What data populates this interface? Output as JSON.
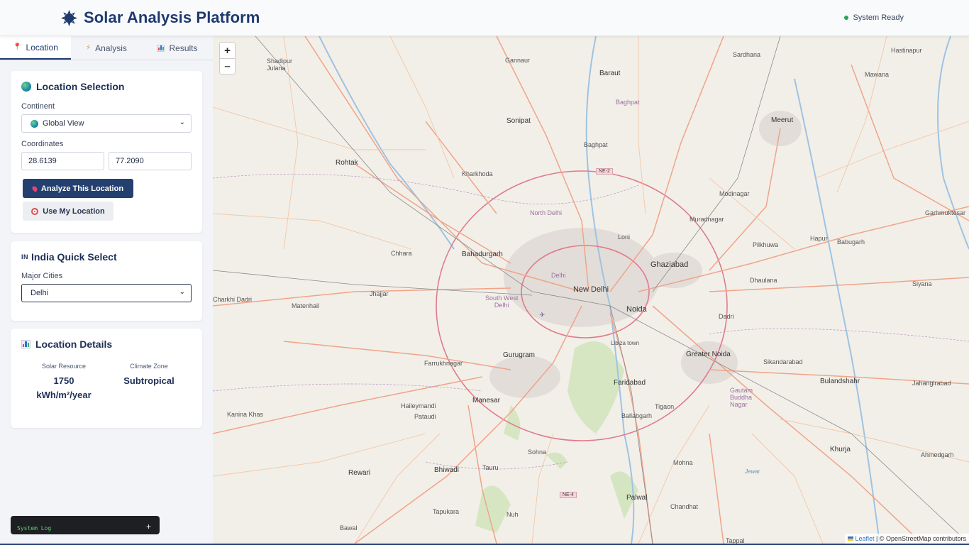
{
  "header": {
    "title": "Solar Analysis Platform",
    "status": "System Ready"
  },
  "tabs": [
    {
      "label": "Location",
      "icon": "pin-icon",
      "active": true
    },
    {
      "label": "Analysis",
      "icon": "lightning-icon",
      "active": false
    },
    {
      "label": "Results",
      "icon": "bar-chart-icon",
      "active": false
    }
  ],
  "location_card": {
    "title": "Location Selection",
    "continent_label": "Continent",
    "continent_value": "Global View",
    "coordinates_label": "Coordinates",
    "latitude": "28.6139",
    "longitude": "77.2090",
    "analyze_button": "Analyze This Location",
    "my_location_button": "Use My Location"
  },
  "india_card": {
    "flag": "IN",
    "title": "India Quick Select",
    "cities_label": "Major Cities",
    "city_value": "Delhi"
  },
  "details_card": {
    "title": "Location Details",
    "solar_label": "Solar Resource",
    "solar_value_num": "1750",
    "solar_value_unit": "kWh/m²/year",
    "climate_label": "Climate Zone",
    "climate_value": "Subtropical"
  },
  "log": {
    "label": "System Log",
    "toggle": "+"
  },
  "map": {
    "zoom_in": "+",
    "zoom_out": "–",
    "attribution_link": "Leaflet",
    "attribution_text": " | © OpenStreetMap contributors",
    "labels": {
      "shadipur_julana": "Shadipur\nJulana",
      "gannaur": "Gannaur",
      "baraut": "Baraut",
      "sardhana": "Sardhana",
      "hastinapur": "Hastinapur",
      "mawana": "Mawana",
      "sonipat": "Sonipat",
      "baghpat": "Baghpat",
      "meerut": "Meerut",
      "rohtak": "Rohtak",
      "kharkhoda": "Kharkhoda",
      "modinagar": "Modinagar",
      "muradnagar": "Muradnagar",
      "garhmuktesar": "Garhmuktesar",
      "north_delhi": "North Delhi",
      "loni": "Loni",
      "hapur": "Hapur",
      "babugarh": "Babugarh",
      "chhara": "Chhara",
      "bahadurgarh": "Bahadurgarh",
      "ghaziabad": "Ghaziabad",
      "pilkhuwa": "Pilkhuwa",
      "delhi": "Delhi",
      "new_delhi": "New Delhi",
      "dhaulana": "Dhaulana",
      "siyana": "Siyana",
      "charkhi_dadri": "Charkhi Dadri",
      "jhajjar": "Jhajjar",
      "matenhail": "Matenhail",
      "south_west_delhi": "South West\nDelhi",
      "noida": "Noida",
      "dadri": "Dadri",
      "gurugram": "Gurugram",
      "greater_noida": "Greater Noida",
      "libaza_town": "Libiza town",
      "farrukhnagar": "Farrukhnagar",
      "sikandarabad": "Sikandarabad",
      "bulandshahr": "Bulandshahr",
      "jahangirabad": "Jahangirabad",
      "faridabad": "Faridabad",
      "gautam_buddha_nagar": "Gautam\nBuddha\nNagar",
      "kanina_khas": "Kanina Khas",
      "haileymandi": "Haileymandi",
      "pataudi": "Pataudi",
      "manesar": "Manesar",
      "tigaon": "Tigaon",
      "ballabgarh": "Ballabgarh",
      "khurja": "Khurja",
      "ahmedgarh": "Ahmedgarh",
      "sohna": "Sohna",
      "mohna": "Mohna",
      "rewari": "Rewari",
      "bhiwadi": "Bhiwadi",
      "tauru": "Tauru",
      "jewar": "Jewar",
      "palwal": "Palwal",
      "chandhat": "Chandhat",
      "tapukara": "Tapukara",
      "nuh": "Nuh",
      "bawal": "Bawal",
      "tappal": "Tappal",
      "ne2": "NE-2",
      "ne4": "NE-4"
    }
  },
  "colors": {
    "brand": "#1e3a6e",
    "primary_button": "#24406f",
    "status_ok": "#22a855",
    "log_text": "#5fd46c"
  }
}
